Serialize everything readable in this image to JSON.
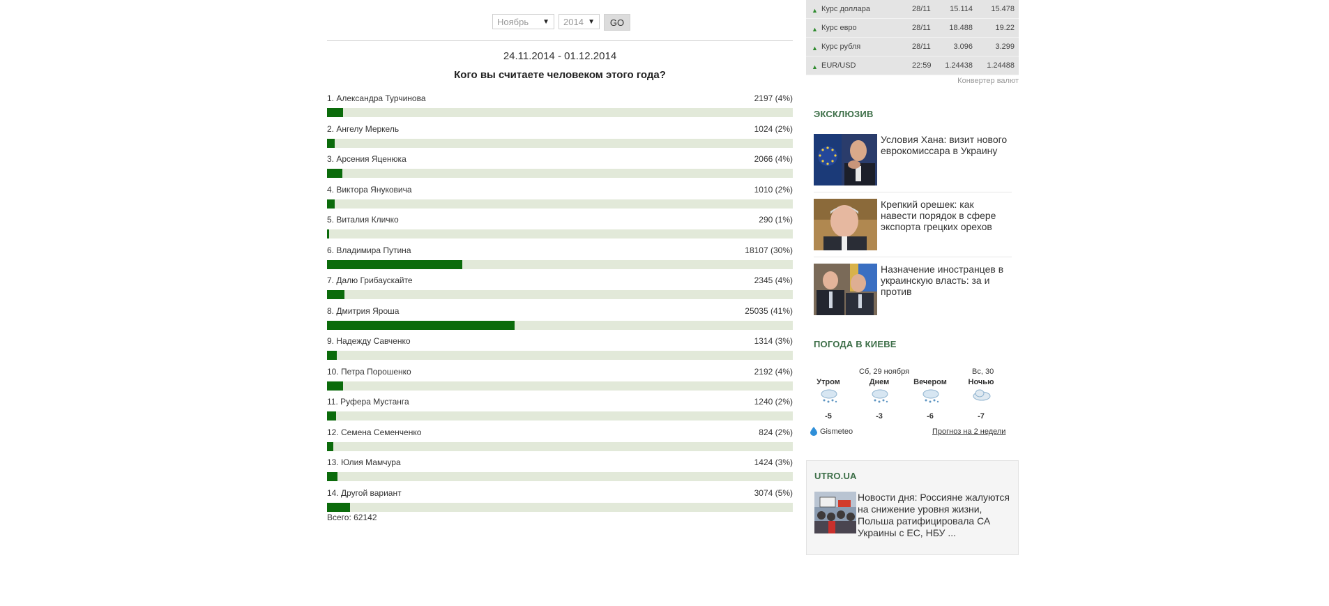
{
  "poll": {
    "month": "Ноябрь",
    "year": "2014",
    "go_label": "GO",
    "period": "24.11.2014 - 01.12.2014",
    "question": "Кого вы считаете человеком этого года?",
    "total": "Всего: 62142",
    "options": [
      {
        "label": "1. Александра Турчинова",
        "count": "2197 (4%)",
        "share": 0.035
      },
      {
        "label": "2. Ангелу Меркель",
        "count": "1024 (2%)",
        "share": 0.016
      },
      {
        "label": "3. Арсения Яценюка",
        "count": "2066 (4%)",
        "share": 0.033
      },
      {
        "label": "4. Виктора Януковича",
        "count": "1010 (2%)",
        "share": 0.016
      },
      {
        "label": "5. Виталия Кличко",
        "count": "290 (1%)",
        "share": 0.005
      },
      {
        "label": "6. Владимира Путина",
        "count": "18107 (30%)",
        "share": 0.291
      },
      {
        "label": "7. Далю Грибаускайте",
        "count": "2345 (4%)",
        "share": 0.038
      },
      {
        "label": "8. Дмитрия Яроша",
        "count": "25035 (41%)",
        "share": 0.403
      },
      {
        "label": "9. Надежду Савченко",
        "count": "1314 (3%)",
        "share": 0.021
      },
      {
        "label": "10. Петра Порошенко",
        "count": "2192 (4%)",
        "share": 0.035
      },
      {
        "label": "11. Руфера Мустанга",
        "count": "1240 (2%)",
        "share": 0.02
      },
      {
        "label": "12. Семена Семенченко",
        "count": "824 (2%)",
        "share": 0.013
      },
      {
        "label": "13. Юлия Мамчура",
        "count": "1424 (3%)",
        "share": 0.023
      },
      {
        "label": "14. Другой вариант",
        "count": "3074 (5%)",
        "share": 0.049
      }
    ]
  },
  "currency": {
    "rows": [
      {
        "name": "Курс доллара",
        "date": "28/11",
        "buy": "15.114",
        "sell": "15.478"
      },
      {
        "name": "Курс евро",
        "date": "28/11",
        "buy": "18.488",
        "sell": "19.22"
      },
      {
        "name": "Курс рубля",
        "date": "28/11",
        "buy": "3.096",
        "sell": "3.299"
      },
      {
        "name": "EUR/USD",
        "date": "22:59",
        "buy": "1.24438",
        "sell": "1.24488"
      }
    ],
    "converter_link": "Конвертер валют",
    "up_color": "#2e8b2e"
  },
  "exclusive": {
    "title": "ЭКСКЛЮЗИВ",
    "items": [
      {
        "text": "Условия Хана: визит нового еврокомиссара в Украину"
      },
      {
        "text": "Крепкий орешек: как навести порядок в сфере экспорта грецких орехов"
      },
      {
        "text": "Назначение иностранцев в украинскую власть: за и против"
      }
    ]
  },
  "weather": {
    "title": "ПОГОДА В КИЕВЕ",
    "day1": "Сб, 29 ноября",
    "day2": "Вс, 30",
    "parts": [
      "Утром",
      "Днем",
      "Вечером",
      "Ночью"
    ],
    "temps": [
      "-5",
      "-3",
      "-6",
      "-7"
    ],
    "provider": "Gismeteo",
    "forecast_link": "Прогноз на 2 недели"
  },
  "utro": {
    "title": "UTRO.UA",
    "text": "Новости дня: Россияне жалуются на снижение уровня жизни, Польша ратифицировала СА Украины с ЕС, НБУ ..."
  },
  "colors": {
    "accent_green": "#3c6e47",
    "bar_fill": "#0b6b0b",
    "bar_track": "#e2e9d9"
  }
}
